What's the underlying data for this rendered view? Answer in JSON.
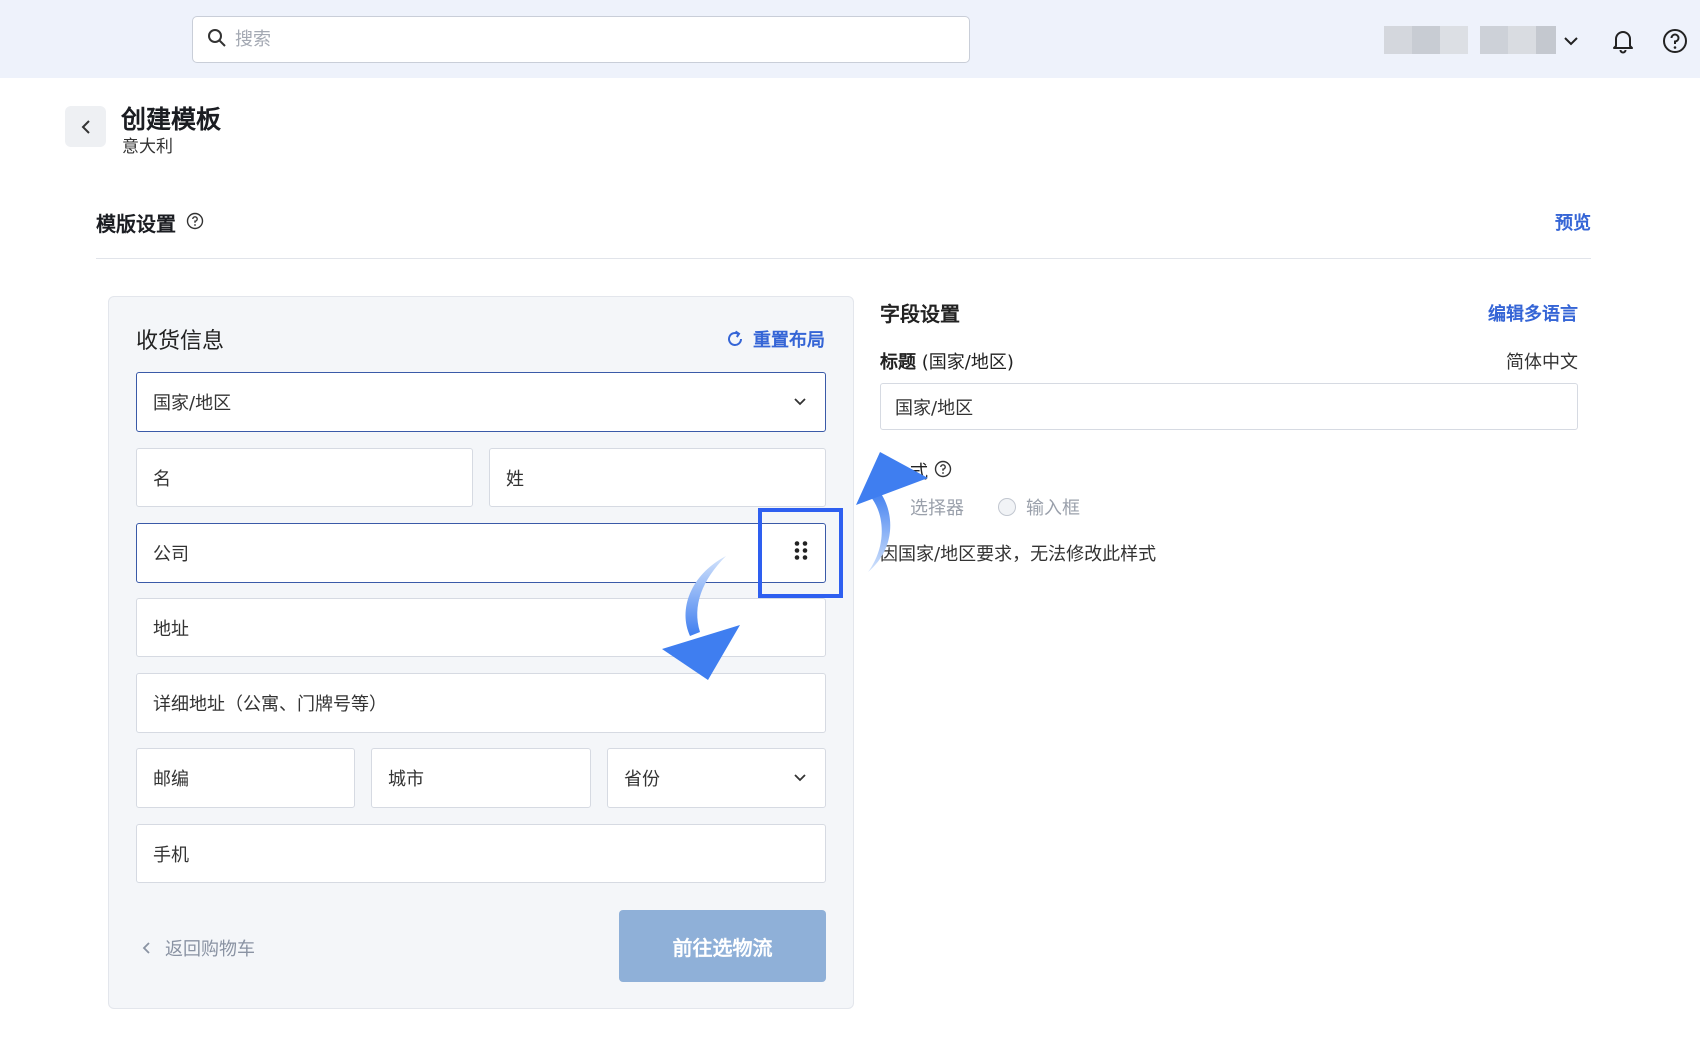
{
  "topbar": {
    "search_placeholder": "搜索",
    "icons": [
      "search-icon",
      "chevron-down-icon",
      "bell-icon",
      "help-icon"
    ]
  },
  "header": {
    "title": "创建模板",
    "subtitle": "意大利"
  },
  "template_settings": {
    "title": "模版设置",
    "preview_label": "预览"
  },
  "shipping_panel": {
    "title": "收货信息",
    "reset_label": "重置布局",
    "fields": {
      "country": "国家/地区",
      "first_name": "名",
      "last_name": "姓",
      "company": "公司",
      "address": "地址",
      "address_detail": "详细地址（公寓、门牌号等）",
      "zip": "邮编",
      "city": "城市",
      "province": "省份",
      "phone": "手机"
    },
    "back_to_cart": "返回购物车",
    "next_button": "前往选物流"
  },
  "field_settings": {
    "title": "字段设置",
    "edit_multilang": "编辑多语言",
    "label_title": "标题",
    "label_title_detail": "(国家/地区)",
    "language": "简体中文",
    "title_value": "国家/地区",
    "style_label": "式",
    "option_selector": "选择器",
    "option_input": "输入框",
    "note": "因国家/地区要求，无法修改此样式"
  },
  "colors": {
    "accent": "#3565d6",
    "highlight": "#2e5ff0",
    "next_button": "#8fb0d8",
    "topbar_bg": "#eef2fb"
  }
}
